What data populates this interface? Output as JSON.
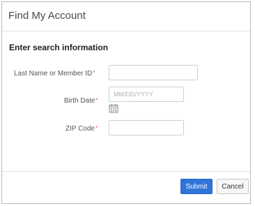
{
  "dialog": {
    "title": "Find My Account",
    "section_heading": "Enter search information"
  },
  "form": {
    "last_name": {
      "label": "Last Name or Member ID",
      "required_mark": "*",
      "value": "",
      "placeholder": ""
    },
    "birth_date": {
      "label": "Birth Date",
      "required_mark": "*",
      "value": "",
      "placeholder": "MM/DD/YYYY",
      "icon": "calendar-icon"
    },
    "zip": {
      "label": "ZIP Code",
      "required_mark": "*",
      "value": "",
      "placeholder": ""
    }
  },
  "footer": {
    "submit_label": "Submit",
    "cancel_label": "Cancel"
  },
  "colors": {
    "primary": "#2f74d8",
    "required": "#d9534f"
  }
}
